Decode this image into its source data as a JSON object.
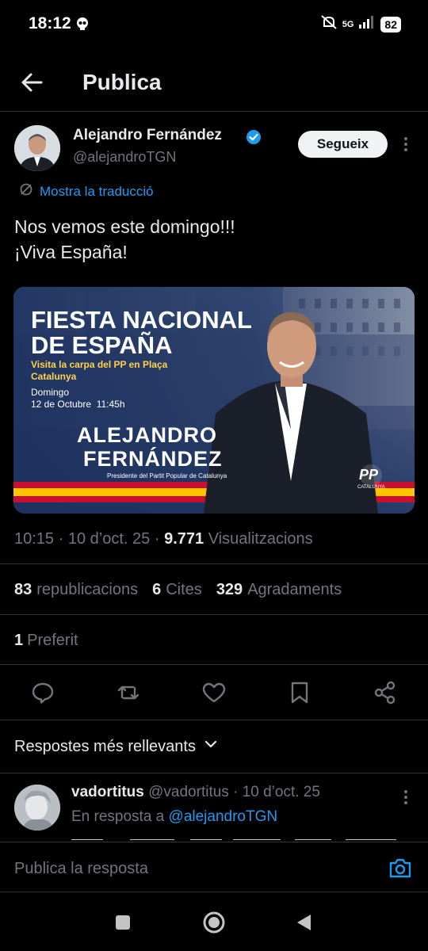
{
  "status": {
    "time": "18:12",
    "network": "5G",
    "battery": "82"
  },
  "header": {
    "title": "Publica"
  },
  "author": {
    "name": "Alejandro Fernández",
    "handle": "@alejandroTGN",
    "follow_label": "Segueix"
  },
  "translate_label": "Mostra la traducció",
  "tweet": {
    "line1": "Nos vemos este domingo!!!",
    "line2": "¡Viva España!"
  },
  "media": {
    "title1": "FIESTA NACIONAL",
    "title2": "DE ESPAÑA",
    "sub1": "Visita la carpa del PP en Plaça",
    "sub2": "Catalunya",
    "date1": "Domingo",
    "date2": "12 de Octubre  11:45h",
    "name1": "ALEJANDRO",
    "name2": "FERNÁNDEZ",
    "role": "Presidente del Partit Popular de Catalunya",
    "logo": "PP",
    "logo_sub": "CATALUNYA"
  },
  "meta": {
    "time": "10:15",
    "sep1": "·",
    "date": "10 d’oct. 25",
    "sep2": "·",
    "views": "9.771",
    "views_label": "Visualitzacions"
  },
  "stats": {
    "reposts": "83",
    "reposts_label": "republicacions",
    "quotes": "6",
    "quotes_label": "Cites",
    "likes": "329",
    "likes_label": "Agradaments"
  },
  "bookmarks": {
    "count": "1",
    "label": "Preferit"
  },
  "replies_filter": "Respostes més rellevants",
  "reply": {
    "name": "vadortitus",
    "handle": "@vadortitus",
    "sep": "·",
    "date": "10 d’oct. 25",
    "in_reply_prefix": "En resposta a",
    "in_reply_handle": "@alejandroTGN"
  },
  "compose": {
    "placeholder": "Publica la resposta"
  },
  "colors": {
    "accent": "#1d9bf0",
    "background": "#000000",
    "muted": "#71767b",
    "text": "#e7e9ea",
    "flag_red": "#c8102e",
    "flag_yellow": "#ffc400"
  },
  "icons": [
    "back-arrow-icon",
    "verified-badge-icon",
    "more-icon",
    "translate-icon",
    "reply-icon",
    "repost-icon",
    "like-icon",
    "bookmark-icon",
    "share-icon",
    "chevron-down-icon",
    "camera-icon",
    "nav-recents-icon",
    "nav-home-icon",
    "nav-back-icon"
  ]
}
